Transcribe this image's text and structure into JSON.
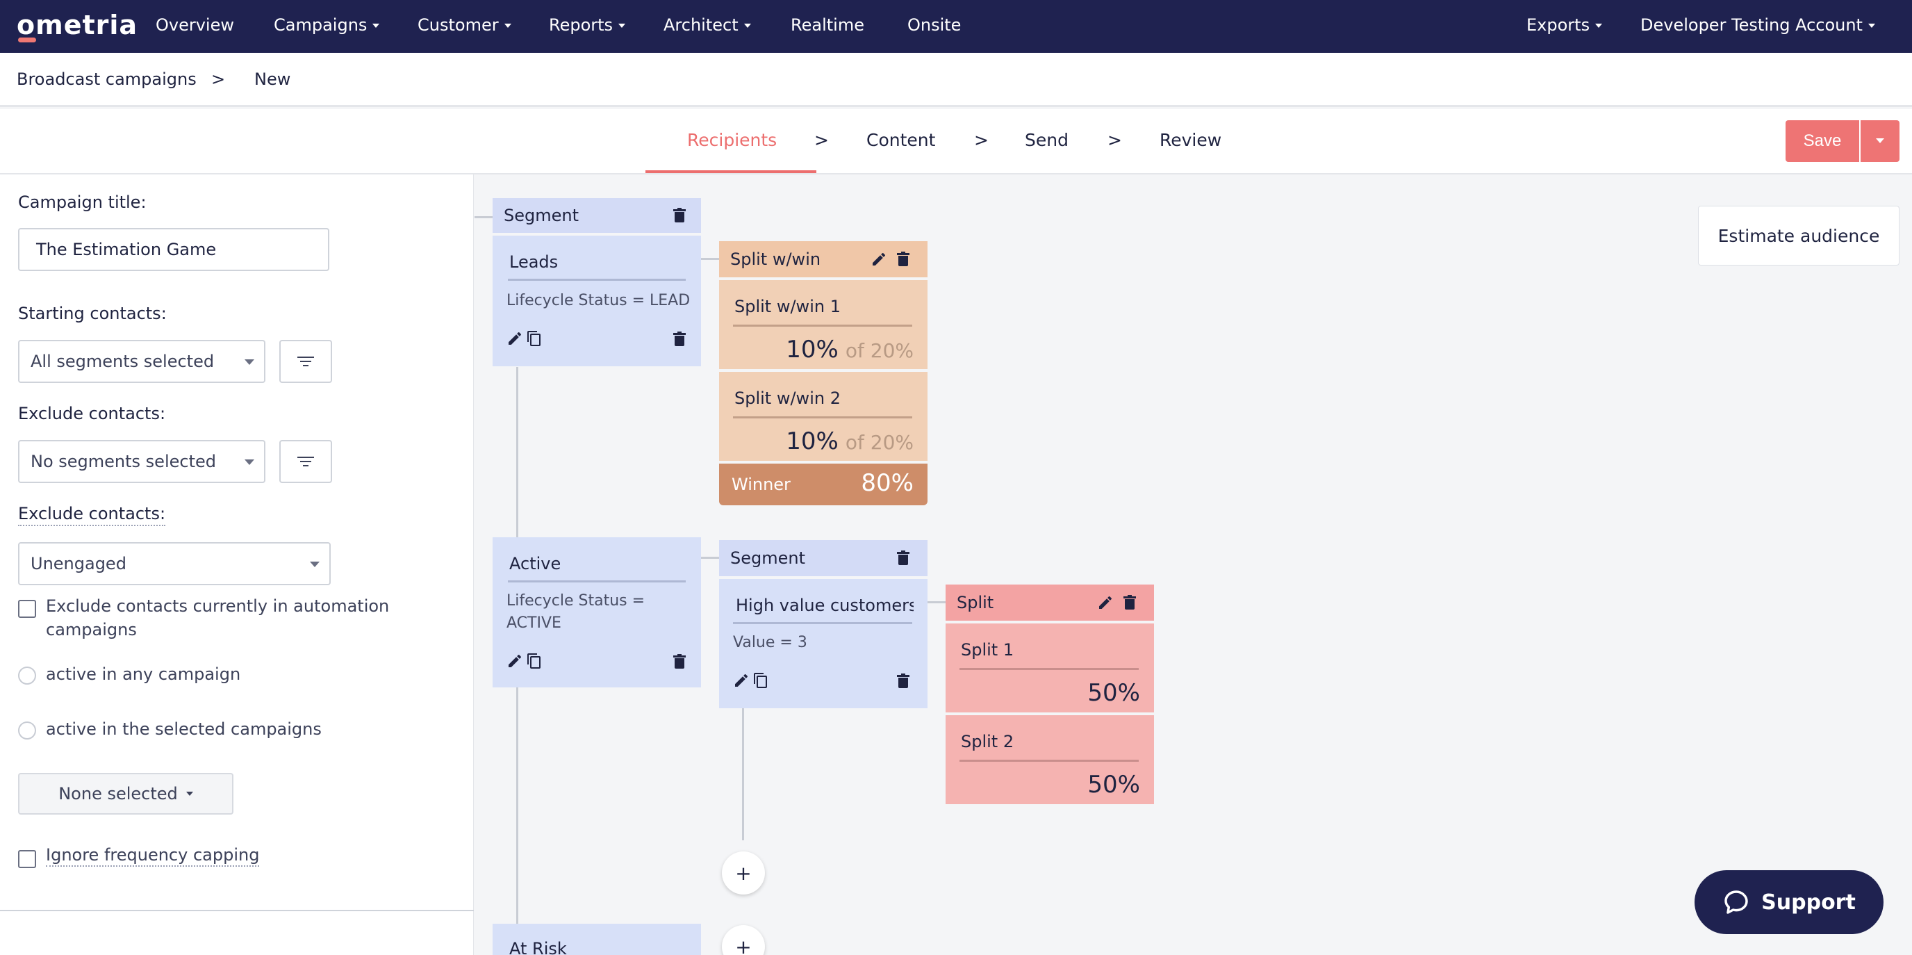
{
  "brand": {
    "logo_text": "ometria",
    "accent": "#ec6e6e",
    "nav_bg": "#1f2250"
  },
  "nav": {
    "items": [
      {
        "label": "Overview",
        "dropdown": false
      },
      {
        "label": "Campaigns",
        "dropdown": true
      },
      {
        "label": "Customer",
        "dropdown": true
      },
      {
        "label": "Reports",
        "dropdown": true
      },
      {
        "label": "Architect",
        "dropdown": true
      },
      {
        "label": "Realtime",
        "dropdown": false
      },
      {
        "label": "Onsite",
        "dropdown": false
      }
    ],
    "right": [
      {
        "label": "Exports",
        "dropdown": true
      },
      {
        "label": "Developer Testing Account",
        "dropdown": true
      }
    ]
  },
  "breadcrumb": {
    "parent": "Broadcast campaigns",
    "separator": ">",
    "current": "New"
  },
  "steps": {
    "items": [
      "Recipients",
      "Content",
      "Send",
      "Review"
    ],
    "separator": ">",
    "active": "Recipients",
    "save_label": "Save"
  },
  "form": {
    "campaign_title_label": "Campaign title:",
    "campaign_title_value": "The Estimation Game",
    "starting_label": "Starting contacts:",
    "starting_value": "All segments selected",
    "exclude_label_1": "Exclude contacts:",
    "exclude_value_1": "No segments selected",
    "exclude_label_2": "Exclude contacts:",
    "exclude_value_2": "Unengaged",
    "exclude_automation": "Exclude contacts currently in automation campaigns",
    "radio_any": "active in any campaign",
    "radio_selected": "active in the selected campaigns",
    "none_selected": "None selected",
    "ignore_capping": "Ignore frequency capping"
  },
  "canvas": {
    "estimate_label": "Estimate audience",
    "segment_node": {
      "title": "Segment"
    },
    "leads": {
      "title": "Leads",
      "rule": "Lifecycle Status = LEAD"
    },
    "split_win": {
      "title": "Split w/win",
      "branch1": {
        "title": "Split w/win 1",
        "pct": "10%",
        "of": "of 20%"
      },
      "branch2": {
        "title": "Split w/win 2",
        "pct": "10%",
        "of": "of 20%"
      },
      "winner": {
        "label": "Winner",
        "pct": "80%"
      }
    },
    "active": {
      "title": "Active",
      "rule": "Lifecycle Status = ACTIVE"
    },
    "segment2": {
      "title": "Segment"
    },
    "high_value": {
      "title": "High value customers",
      "rule": "Value = 3"
    },
    "split": {
      "title": "Split",
      "branch1": {
        "title": "Split 1",
        "pct": "50%"
      },
      "branch2": {
        "title": "Split 2",
        "pct": "50%"
      }
    },
    "at_risk": {
      "title": "At Risk"
    },
    "plus": "+"
  },
  "support": {
    "label": "Support"
  },
  "icons": [
    "pencil-icon",
    "copy-icon",
    "trash-icon",
    "filter-icon",
    "chat-bubble-icon",
    "plus-icon"
  ]
}
